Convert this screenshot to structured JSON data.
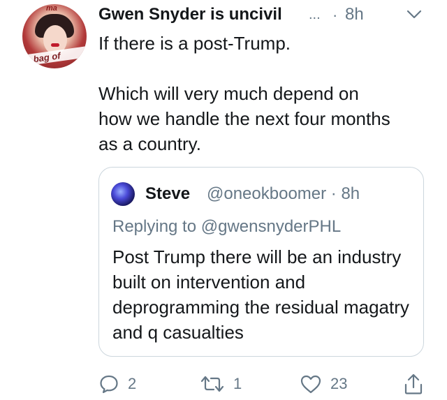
{
  "tweet": {
    "author_name": "Gwen Snyder is uncivil",
    "name_overflow": "...",
    "separator": "·",
    "time": "8h",
    "avatar_text_top": "ma",
    "avatar_text_band": "a bag of",
    "text_line1": "If there is a post-Trump.",
    "text_line2": "Which will very much depend on\nhow we handle the next four months\nas a country."
  },
  "quoted_tweet": {
    "author_name": "Steve",
    "handle_time": "@oneokboomer · 8h",
    "replying_to": "Replying to @gwensnyderPHL",
    "text": "Post Trump there will be an industry built on intervention and deprogramming the residual magatry and q casualties"
  },
  "actions": {
    "replies": "2",
    "retweets": "1",
    "likes": "23",
    "icons": [
      "reply-icon",
      "retweet-icon",
      "like-icon",
      "share-icon"
    ]
  },
  "colors": {
    "text": "#14171a",
    "secondary": "#657786",
    "border": "#ccd6dd"
  }
}
